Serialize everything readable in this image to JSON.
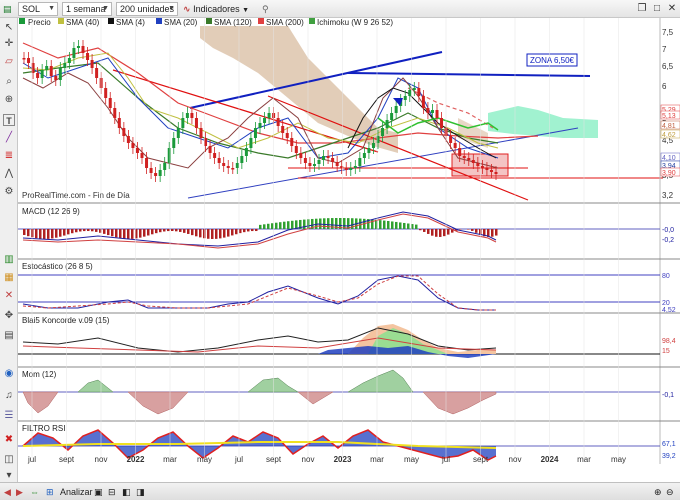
{
  "toolbar": {
    "symbol": "SOL",
    "period": "1 semana",
    "units": "200 unidades",
    "indicators_label": "Indicadores"
  },
  "legend": {
    "price": "Precio",
    "sma40": "SMA (40)",
    "sma4": "SMA (4)",
    "sma20": "SMA (20)",
    "sma120": "SMA (120)",
    "sma200": "SMA (200)",
    "ichimoku": "Ichimoku (W 9 26 52)",
    "source": "ProRealTime.com - Fin de Día"
  },
  "annotations": {
    "zona": "ZONA 6,50€"
  },
  "price_axis": {
    "ticks": [
      "7,5",
      "7",
      "6,5",
      "6",
      "5",
      "4,5",
      "4",
      "3,5",
      "3,2"
    ],
    "markers": [
      {
        "text": "5,29",
        "color": "#e04040"
      },
      {
        "text": "5,13",
        "color": "#e04040"
      },
      {
        "text": "4,81",
        "color": "#c06040"
      },
      {
        "text": "4,62",
        "color": "#c0a040"
      },
      {
        "text": "4,10",
        "color": "#6060c0"
      },
      {
        "text": "3,94",
        "color": "#2040a0"
      },
      {
        "text": "3,90",
        "color": "#e04040"
      }
    ]
  },
  "panels": {
    "macd": {
      "label": "MACD (12 26 9)",
      "values": [
        "-0,0",
        "-0,2"
      ]
    },
    "stoch": {
      "label": "Estocástico (26 8 5)",
      "values": [
        "80",
        "20",
        "4,52"
      ]
    },
    "koncorde": {
      "label": "Blai5 Koncorde v.09 (15)",
      "values": [
        "98,4",
        "15"
      ]
    },
    "mom": {
      "label": "Mom (12)",
      "values": [
        "-0,1"
      ]
    },
    "rsi": {
      "label": "FILTRO RSI",
      "values": [
        "67,1",
        "39,2"
      ]
    }
  },
  "time_axis": {
    "labels": [
      {
        "text": "jul"
      },
      {
        "text": "sept"
      },
      {
        "text": "nov"
      },
      {
        "text": "2022",
        "bold": true
      },
      {
        "text": "mar"
      },
      {
        "text": "may"
      },
      {
        "text": "jul"
      },
      {
        "text": "sept"
      },
      {
        "text": "nov"
      },
      {
        "text": "2023",
        "bold": true
      },
      {
        "text": "mar"
      },
      {
        "text": "may"
      },
      {
        "text": "jul"
      },
      {
        "text": "sept"
      },
      {
        "text": "nov"
      },
      {
        "text": "2024",
        "bold": true
      },
      {
        "text": "mar"
      },
      {
        "text": "may"
      }
    ]
  },
  "bottombar": {
    "analyze_label": "Analizar"
  },
  "colors": {
    "price_up": "#1a9a3a",
    "price_down": "#d02020",
    "trend_blue": "#1020c0",
    "trend_red": "#e01010",
    "cloud_brown": "#c8a888",
    "cloud_green": "#80e8c0"
  }
}
